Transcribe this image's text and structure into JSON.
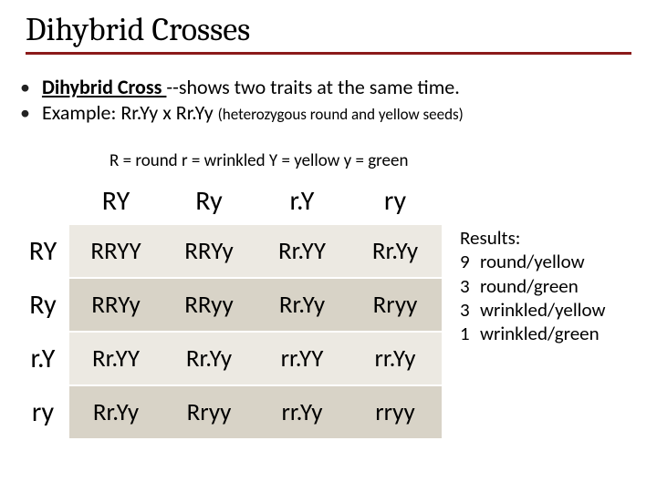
{
  "title": "Dihybrid Crosses",
  "bullet1_term": "Dihybrid Cross ",
  "bullet1_rest": "--shows two traits at the same time.",
  "bullet2_a": "Example:  Rr.Yy     x     Rr.Yy  ",
  "bullet2_paren": "(heterozygous round and yellow seeds)",
  "legend": "R = round   r = wrinkled   Y = yellow   y = green",
  "cols": [
    "RY",
    "Ry",
    "r.Y",
    "ry"
  ],
  "rows": [
    "RY",
    "Ry",
    "r.Y",
    "ry"
  ],
  "cells": [
    [
      "RRYY",
      "RRYy",
      "Rr.YY",
      "Rr.Yy"
    ],
    [
      "RRYy",
      "RRyy",
      "Rr.Yy",
      "Rryy"
    ],
    [
      "Rr.YY",
      "Rr.Yy",
      "rr.YY",
      "rr.Yy"
    ],
    [
      "Rr.Yy",
      "Rryy",
      "rr.Yy",
      "rryy"
    ]
  ],
  "results_title": "Results:",
  "results": [
    {
      "n": "9",
      "label": "round/yellow"
    },
    {
      "n": "3",
      "label": "round/green"
    },
    {
      "n": "3",
      "label": "wrinkled/yellow"
    },
    {
      "n": "1",
      "label": "wrinkled/green"
    }
  ],
  "chart_data": {
    "type": "table",
    "title": "Dihybrid Cross Punnett Square (RrYy x RrYy)",
    "row_headers": [
      "RY",
      "Ry",
      "rY",
      "ry"
    ],
    "col_headers": [
      "RY",
      "Ry",
      "rY",
      "ry"
    ],
    "grid": [
      [
        "RRYY",
        "RRYy",
        "RrYY",
        "RrYy"
      ],
      [
        "RRYy",
        "RRyy",
        "RrYy",
        "Rryy"
      ],
      [
        "RrYY",
        "RrYy",
        "rrYY",
        "rrYy"
      ],
      [
        "RrYy",
        "Rryy",
        "rrYy",
        "rryy"
      ]
    ],
    "phenotype_ratio": {
      "round_yellow": 9,
      "round_green": 3,
      "wrinkled_yellow": 3,
      "wrinkled_green": 1
    },
    "allele_key": {
      "R": "round",
      "r": "wrinkled",
      "Y": "yellow",
      "y": "green"
    }
  }
}
